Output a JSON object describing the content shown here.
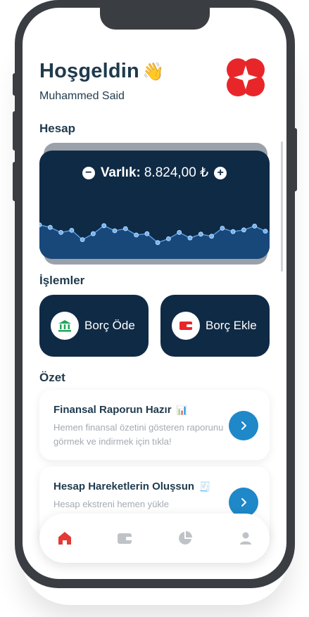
{
  "header": {
    "greeting": "Hoşgeldin",
    "greeting_emoji": "👋",
    "user_name": "Muhammed Said",
    "logo_icon": "red-flower-logo-icon"
  },
  "account": {
    "section_title": "Hesap",
    "balance_label": "Varlık:",
    "balance_value": "8.824,00 ₺",
    "decrease_icon": "minus-circle-icon",
    "increase_icon": "plus-circle-icon"
  },
  "actions": {
    "section_title": "İşlemler",
    "items": [
      {
        "label": "Borç Öde",
        "icon": "bank-icon"
      },
      {
        "label": "Borç Ekle",
        "icon": "wallet-icon"
      }
    ]
  },
  "summary": {
    "section_title": "Özet",
    "cards": [
      {
        "title": "Finansal Raporun Hazır",
        "emoji": "📊",
        "description": "Hemen finansal özetini gösteren raporunu görmek ve indirmek için tıkla!"
      },
      {
        "title": "Hesap Hareketlerin Oluşsun",
        "emoji": "🧾",
        "description": "Hesap ekstreni hemen yükle"
      }
    ]
  },
  "navigation": {
    "items": [
      {
        "icon": "home-icon",
        "active": true
      },
      {
        "icon": "wallet-icon",
        "active": false
      },
      {
        "icon": "pie-chart-icon",
        "active": false
      },
      {
        "icon": "user-icon",
        "active": false
      }
    ],
    "active_color": "#e53935",
    "inactive_color": "#bfc3c8"
  },
  "colors": {
    "primary_dark": "#0f2a45",
    "accent_blue": "#1e88c8",
    "logo_red": "#e8262a"
  },
  "chart_data": {
    "type": "area",
    "values": [
      64,
      58,
      46,
      51,
      29,
      43,
      62,
      50,
      55,
      40,
      43,
      22,
      31,
      46,
      33,
      42,
      37,
      56,
      48,
      52,
      61,
      49
    ]
  }
}
